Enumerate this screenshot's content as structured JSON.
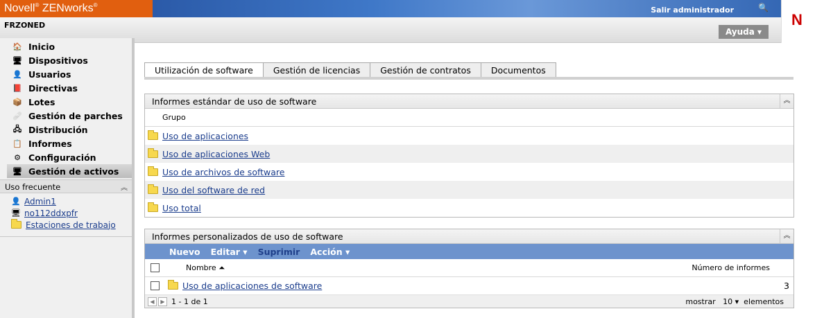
{
  "header": {
    "brand": "Novell",
    "brand_product": "ZENworks",
    "reg_mark": "®",
    "logout": "Salir administrador",
    "zone": "FRZONED",
    "help": "Ayuda",
    "logo_letter": "N"
  },
  "sidebar": {
    "items": [
      {
        "label": "Inicio"
      },
      {
        "label": "Dispositivos"
      },
      {
        "label": "Usuarios"
      },
      {
        "label": "Directivas"
      },
      {
        "label": "Lotes"
      },
      {
        "label": "Gestión de parches"
      },
      {
        "label": "Distribución"
      },
      {
        "label": "Informes"
      },
      {
        "label": "Configuración"
      },
      {
        "label": "Gestión de activos"
      }
    ],
    "frequent_title": "Uso frecuente",
    "frequent": [
      {
        "label": "Admin1"
      },
      {
        "label": "no112ddxpfr"
      },
      {
        "label": "Estaciones de trabajo"
      }
    ]
  },
  "tabs": [
    "Utilización de software",
    "Gestión de licencias",
    "Gestión de contratos",
    "Documentos"
  ],
  "standard": {
    "title": "Informes estándar de uso de software",
    "group_header": "Grupo",
    "rows": [
      "Uso de aplicaciones",
      "Uso de aplicaciones Web",
      "Uso de archivos de software",
      "Uso del software de red",
      "Uso total"
    ]
  },
  "custom": {
    "title": "Informes personalizados de uso de software",
    "toolbar": {
      "new": "Nuevo",
      "edit": "Editar",
      "delete": "Suprimir",
      "action": "Acción"
    },
    "col_name": "Nombre",
    "col_count": "Número de informes",
    "rows": [
      {
        "name": "Uso de aplicaciones de software",
        "count": "3"
      }
    ],
    "pager": {
      "range": "1 - 1 de 1",
      "show": "mostrar",
      "per_page": "10",
      "items": "elementos"
    }
  }
}
